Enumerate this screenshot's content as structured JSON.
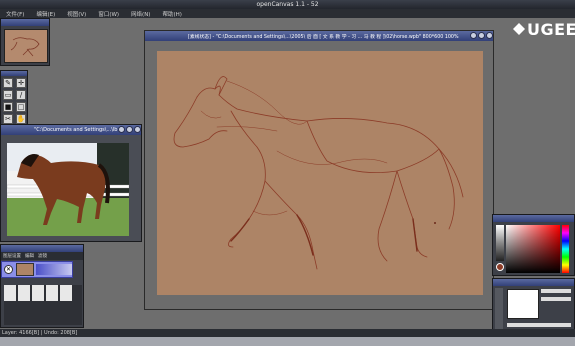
{
  "app": {
    "title": "openCanvas 1.1 - 52"
  },
  "menu": [
    "文件(F)",
    "编辑(E)",
    "视图(V)",
    "窗口(W)",
    "网络(N)",
    "帮助(H)"
  ],
  "brand": {
    "logo_text": "UGEE"
  },
  "canvas_window": {
    "title": "[素线状态] - \"C:\\Documents and Settings\\...\\2005\\ 后 面 [ 文 系 教 学 - 习 ... 马 教 程 ]\\02\\horse.wpb\" 800*600 100%"
  },
  "reference_window": {
    "title": "\"C:\\Documents and Settings\\...\\lb"
  },
  "layer_panel": {
    "menu": [
      "图层设置",
      "编辑",
      "滤镜"
    ]
  },
  "status": {
    "text": "Layer: 4166[B] | Undo: 208[B]"
  },
  "colors": {
    "canvas_bg": "#ad8466",
    "paper_frame": "#ae8870",
    "sketch": "#8c3c28",
    "title_blue": "#324078"
  }
}
